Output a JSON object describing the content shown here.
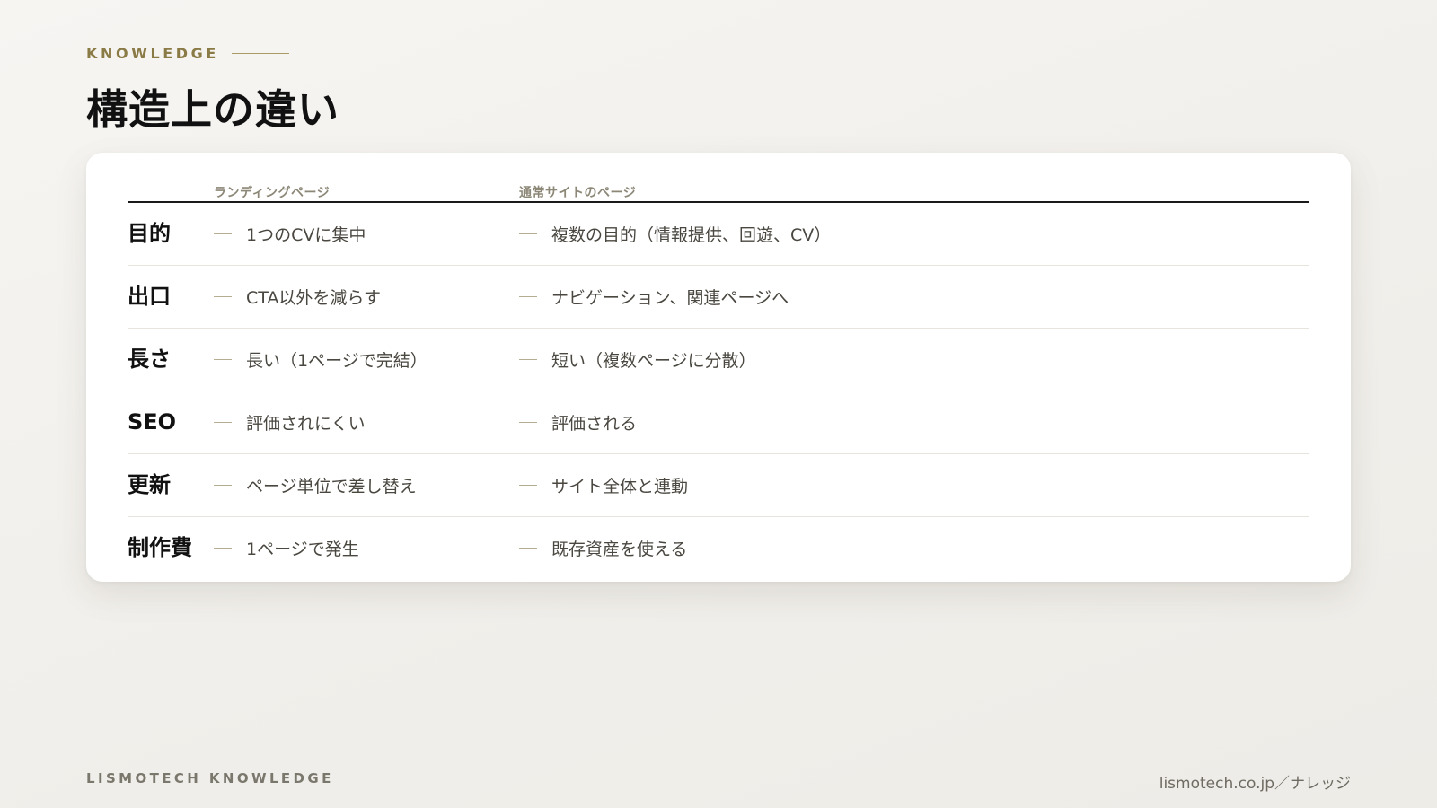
{
  "header": {
    "eyebrow": "KNOWLEDGE",
    "title": "構造上の違い"
  },
  "table": {
    "columns": [
      "ランディングページ",
      "通常サイトのページ"
    ],
    "rows": [
      {
        "label": "目的",
        "lp": "1つのCVに集中",
        "site": "複数の目的（情報提供、回遊、CV）"
      },
      {
        "label": "出口",
        "lp": "CTA以外を減らす",
        "site": "ナビゲーション、関連ページへ"
      },
      {
        "label": "長さ",
        "lp": "長い（1ページで完結）",
        "site": "短い（複数ページに分散）"
      },
      {
        "label": "SEO",
        "lp": "評価されにくい",
        "site": "評価される"
      },
      {
        "label": "更新",
        "lp": "ページ単位で差し替え",
        "site": "サイト全体と連動"
      },
      {
        "label": "制作費",
        "lp": "1ページで発生",
        "site": "既存資産を使える"
      }
    ]
  },
  "footer": {
    "brand": "LISMOTECH KNOWLEDGE",
    "url": "lismotech.co.jp／ナレッジ"
  },
  "colors": {
    "accent": "#8a7a45",
    "background": "#f3f1ed",
    "card": "#ffffff",
    "text": "#111111"
  }
}
